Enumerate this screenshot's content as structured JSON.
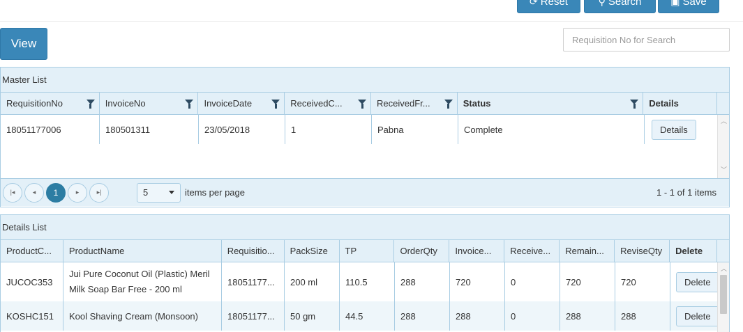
{
  "toolbar": {
    "reset_label": "Reset",
    "search_label": "Search",
    "save_label": "Save"
  },
  "view_label": "View",
  "search": {
    "placeholder": "Requisition No for Search"
  },
  "master": {
    "title": "Master List",
    "columns": [
      "RequisitionNo",
      "InvoiceNo",
      "InvoiceDate",
      "ReceivedC...",
      "ReceivedFr...",
      "Status",
      "Details"
    ],
    "rows": [
      {
        "requisition_no": "18051177006",
        "invoice_no": "180501311",
        "invoice_date": "23/05/2018",
        "received_c": "1",
        "received_from": "Pabna",
        "status": "Complete",
        "details_label": "Details"
      }
    ],
    "pager": {
      "current_page": "1",
      "page_size": "5",
      "items_per_page_label": "items per page",
      "info": "1 - 1 of 1 items"
    }
  },
  "details": {
    "title": "Details List",
    "columns": [
      "ProductC...",
      "ProductName",
      "Requisitio...",
      "PackSize",
      "TP",
      "OrderQty",
      "Invoice...",
      "Receive...",
      "Remain...",
      "ReviseQty",
      "Delete"
    ],
    "rows": [
      {
        "product_code": "JUCOC353",
        "product_name": "Jui Pure Coconut Oil (Plastic) Meril Milk Soap Bar Free - 200 ml",
        "requisition": "18051177...",
        "pack_size": "200 ml",
        "tp": "110.5",
        "order_qty": "288",
        "invoice": "720",
        "received": "0",
        "remain": "720",
        "revise_qty": "720",
        "delete_label": "Delete"
      },
      {
        "product_code": "KOSHC151",
        "product_name": "Kool Shaving Cream (Monsoon)",
        "requisition": "18051177...",
        "pack_size": "50 gm",
        "tp": "44.5",
        "order_qty": "288",
        "invoice": "288",
        "received": "0",
        "remain": "288",
        "revise_qty": "288",
        "delete_label": "Delete"
      }
    ]
  }
}
